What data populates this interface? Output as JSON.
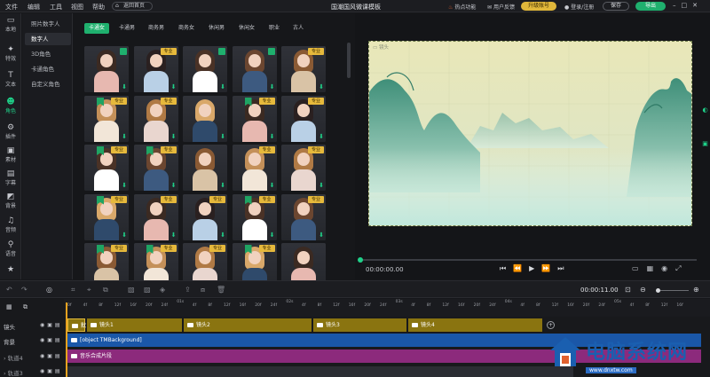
{
  "menu": {
    "file": "文件",
    "edit": "编辑",
    "tools": "工具",
    "view": "视图",
    "help": "帮助"
  },
  "home_button": "返回首页",
  "doc_title": "国潮国风微课模板",
  "hot_features": "热点功能",
  "feedback": "用户反馈",
  "upgrade": "升级账号",
  "login": "登录/注册",
  "save": "保存",
  "export": "导出",
  "rail": [
    {
      "label": "本地",
      "icon": "folder-icon"
    },
    {
      "label": "特效",
      "icon": "sparkle-icon"
    },
    {
      "label": "文本",
      "icon": "text-icon"
    },
    {
      "label": "角色",
      "icon": "person-icon"
    },
    {
      "label": "插件",
      "icon": "plugin-icon"
    },
    {
      "label": "素材",
      "icon": "image-icon"
    },
    {
      "label": "字幕",
      "icon": "subtitle-icon"
    },
    {
      "label": "背景",
      "icon": "background-icon"
    },
    {
      "label": "音频",
      "icon": "music-icon"
    },
    {
      "label": "语音",
      "icon": "voice-icon"
    },
    {
      "label": "",
      "icon": "star-icon"
    }
  ],
  "categories": [
    "照片数字人",
    "数字人",
    "3D角色",
    "卡通角色",
    "自定义角色"
  ],
  "filters": [
    "卡通女",
    "卡通男",
    "商务男",
    "商务女",
    "休闲男",
    "休闲女",
    "职业",
    "古人"
  ],
  "pro_label": "专业",
  "canvas_label": "镜头",
  "timecode": "00:00:00.00",
  "duration": "00:00:11.00",
  "ruler_ticks": [
    "0f",
    "4f",
    "8f",
    "12f",
    "16f",
    "20f",
    "24f",
    "01s",
    "4f",
    "8f",
    "12f",
    "16f",
    "20f",
    "24f",
    "02s",
    "4f",
    "8f",
    "12f",
    "16f",
    "20f",
    "24f",
    "03s",
    "4f",
    "8f",
    "12f",
    "16f",
    "20f",
    "24f",
    "04s",
    "4f",
    "8f",
    "12f",
    "16f",
    "20f",
    "24f",
    "05s",
    "4f",
    "8f",
    "12f",
    "16f"
  ],
  "tracks": {
    "camera": {
      "label": "镜头",
      "clips": [
        "默认",
        "镜头1",
        "镜头2",
        "镜头3",
        "镜头4"
      ]
    },
    "background": {
      "label": "背景",
      "clip": "[object TMBackground]"
    },
    "track4": {
      "label": "轨道4",
      "clip": "音乐合成片段"
    },
    "track3": {
      "label": "轨道3"
    }
  },
  "watermark": {
    "text": "电脑系统网",
    "url": "www.dnxtw.com"
  },
  "colors": {
    "accent": "#1fb06e",
    "gold": "#e6b93c",
    "camera_track": "#8a7410",
    "bg_track": "#1a57a8",
    "music_track": "#8c2a7c"
  }
}
